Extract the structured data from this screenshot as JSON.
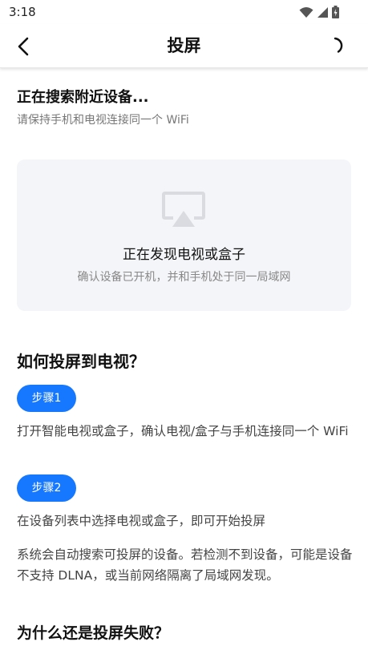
{
  "status_bar": {
    "time": "3:18",
    "icons": [
      "wifi-icon",
      "signal-icon",
      "battery-charging-icon"
    ]
  },
  "header": {
    "title": "投屏",
    "back_icon": "chevron-left-icon",
    "refresh_icon": "loading-spinner-icon"
  },
  "search": {
    "title": "正在搜索附近设备...",
    "subtitle": "请保持手机和电视连接同一个 WiFi"
  },
  "device_card": {
    "icon": "airplay-icon",
    "title": "正在发现电视或盒子",
    "subtitle": "确认设备已开机，并和手机处于同一局域网"
  },
  "howto": {
    "title": "如何投屏到电视？",
    "steps": [
      {
        "label": "步骤1",
        "text": "打开智能电视或盒子，确认电视/盒子与手机连接同一个 WiFi"
      },
      {
        "label": "步骤2",
        "text": "在设备列表中选择电视或盒子，即可开始投屏"
      }
    ],
    "note": "系统会自动搜索可投屏的设备。若检测不到设备，可能是设备不支持 DLNA，或当前网络隔离了局域网发现。"
  },
  "why": {
    "title": "为什么还是投屏失败？"
  },
  "colors": {
    "accent": "#1677ff",
    "card_bg": "#f4f5f8",
    "icon_gray": "#d9dbe0"
  }
}
